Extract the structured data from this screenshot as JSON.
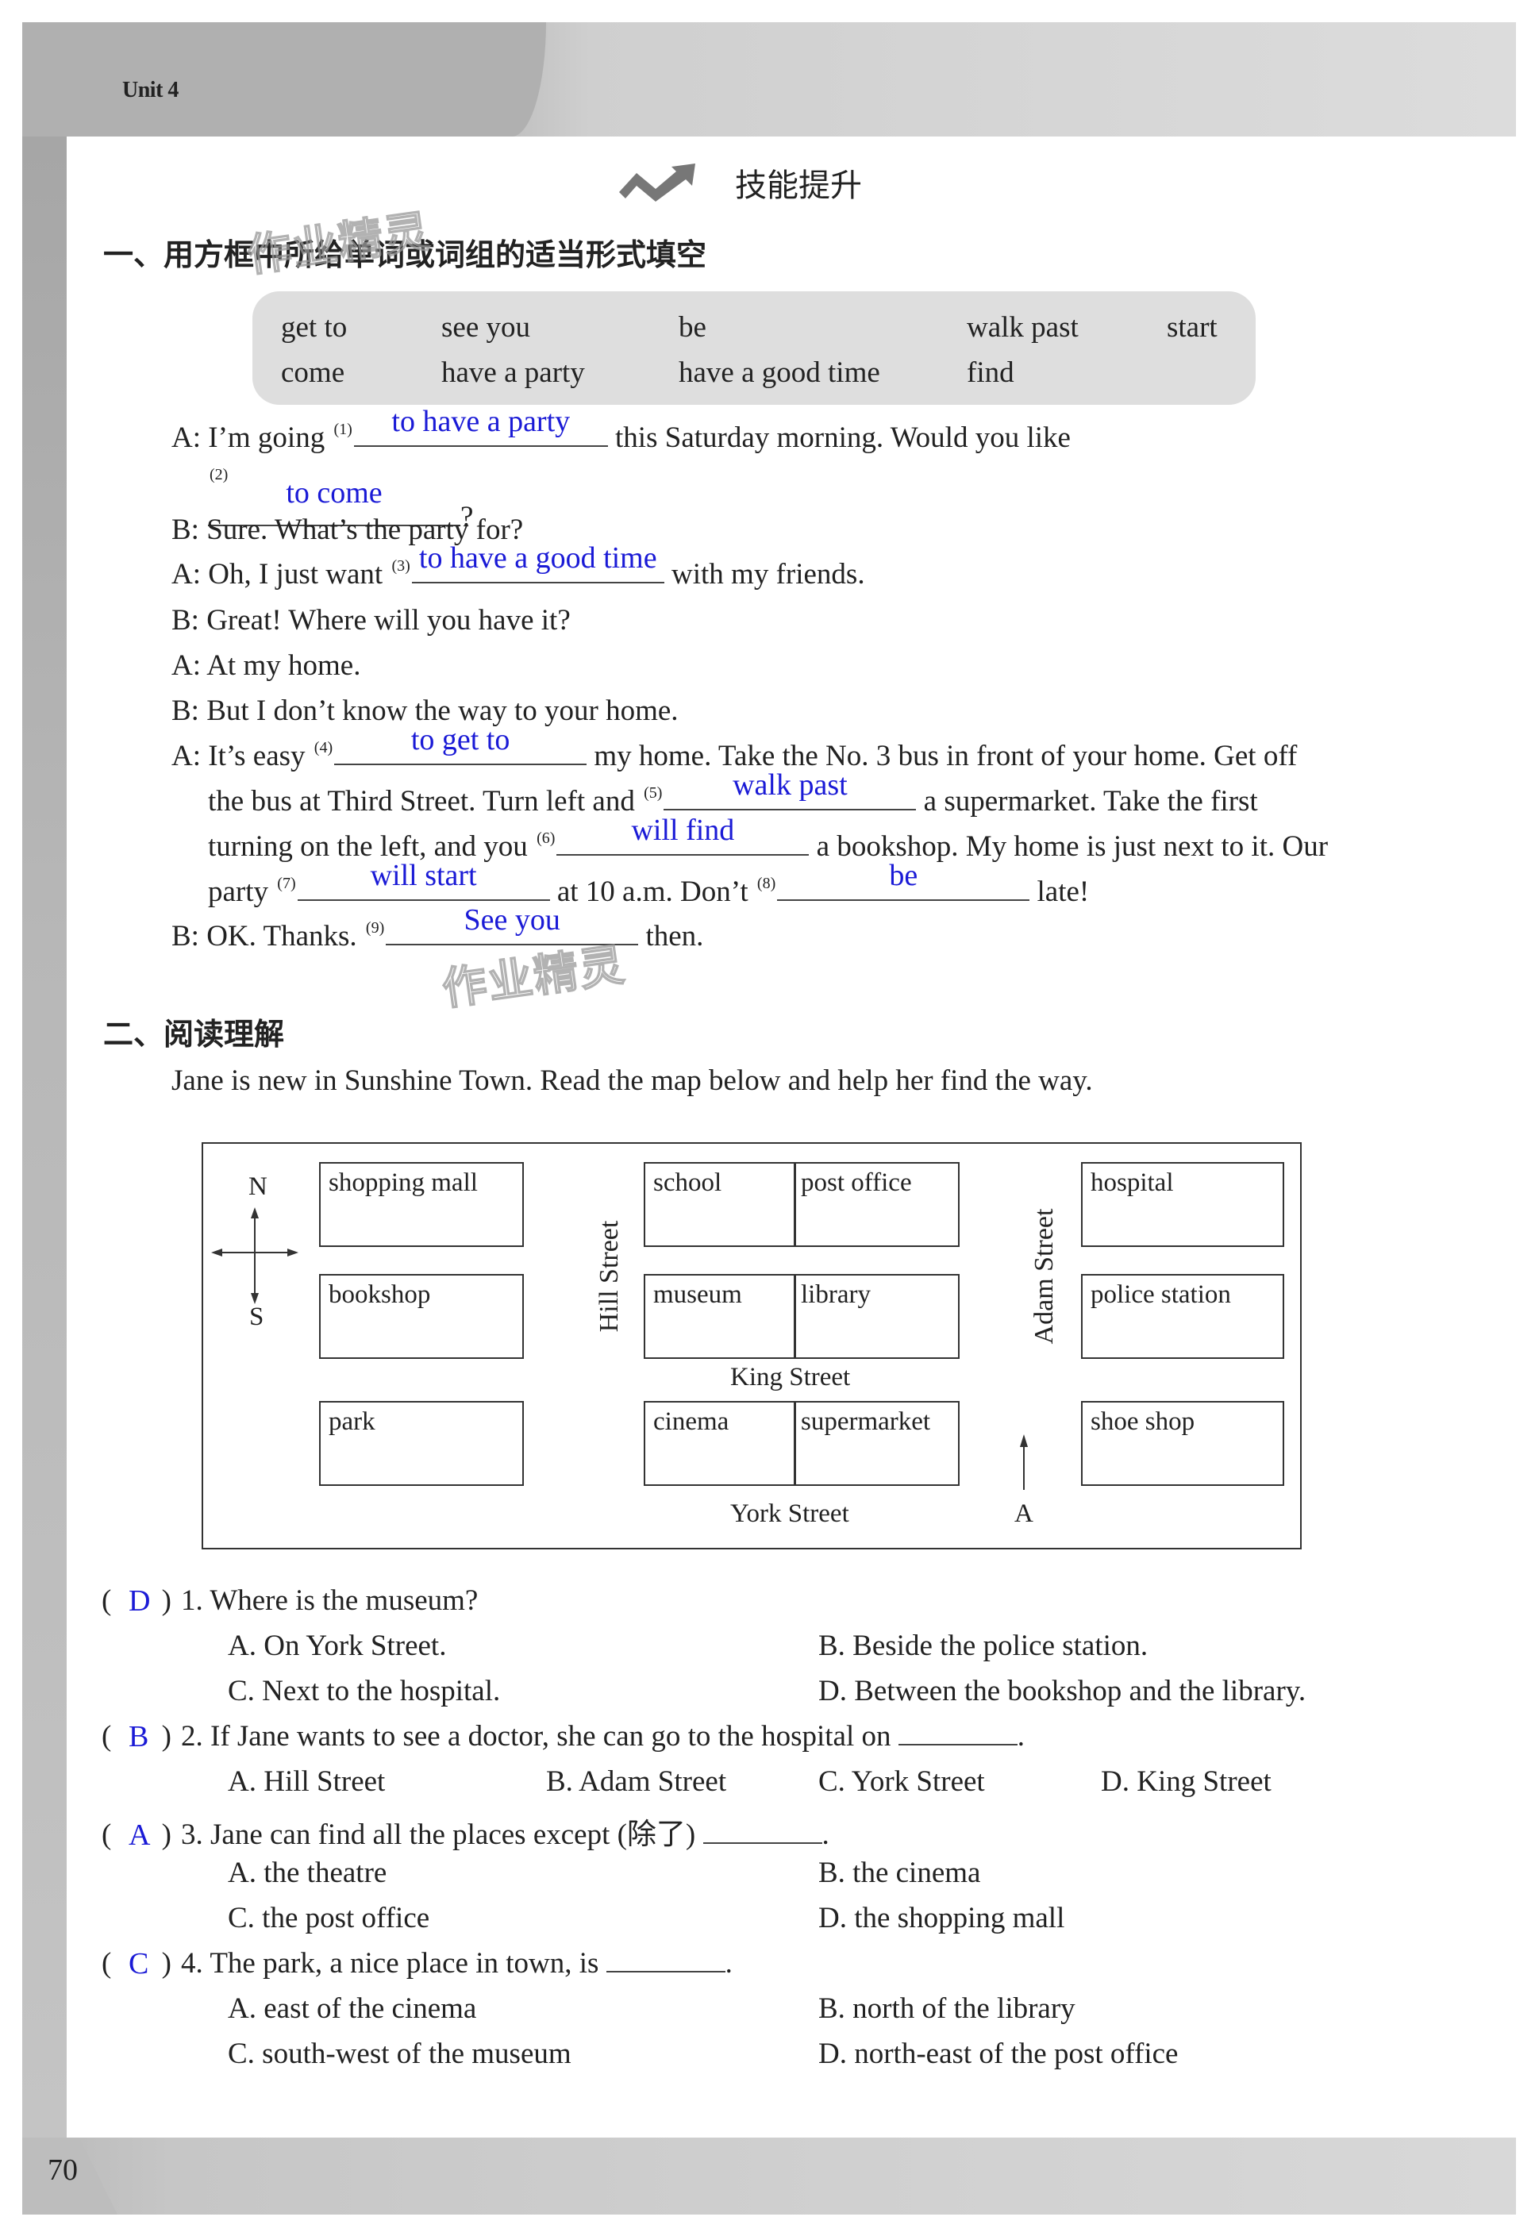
{
  "header": {
    "unit_label": "Unit 4",
    "skill_title": "技能提升",
    "skill_icon": "trend-up-arrow-icon",
    "page_number": "70"
  },
  "watermark": "作业精灵",
  "section1": {
    "title": "一、用方框中所给单词或词组的适当形式填空",
    "word_bank": [
      [
        "get to",
        "see you",
        "be",
        "walk past",
        "start"
      ],
      [
        "come",
        "have a party",
        "have a good time",
        "find"
      ]
    ],
    "lines": {
      "l1": {
        "pre": "A: I’m going",
        "num": "(1)",
        "answer": "to have a party",
        "post": "this Saturday morning. Would you like"
      },
      "l2": {
        "num": "(2)",
        "answer": "to come",
        "post": "?"
      },
      "l3": "B: Sure. What’s the party for?",
      "l4": {
        "pre": "A: Oh, I just want",
        "num": "(3)",
        "answer": "to have a good time",
        "post": "with my friends."
      },
      "l5": "B: Great! Where will you have it?",
      "l6": "A: At my home.",
      "l7": "B: But I don’t know the way to your home.",
      "l8": {
        "pre": "A: It’s easy",
        "num": "(4)",
        "answer": "to get to",
        "post": "my home. Take the No. 3 bus in front of your home. Get off"
      },
      "l9": {
        "pre": "the bus at Third Street. Turn left and",
        "num": "(5)",
        "answer": "walk past",
        "post": "a supermarket. Take the first"
      },
      "l10": {
        "pre": "turning on the left, and you",
        "num": "(6)",
        "answer": "will find",
        "post": "a bookshop. My home is just next to it. Our"
      },
      "l11": {
        "pre": "party",
        "num": "(7)",
        "answer": "will start",
        "mid": "at 10 a.m. Don’t",
        "num2": "(8)",
        "answer2": "be",
        "post": "late!"
      },
      "l12": {
        "pre": "B: OK. Thanks.",
        "num": "(9)",
        "answer": "See you",
        "post": "then."
      }
    }
  },
  "section2": {
    "title": "二、阅读理解",
    "intro": "Jane is new in Sunshine Town. Read the map below and help her find the way.",
    "map": {
      "compass": {
        "north": "N",
        "south": "S"
      },
      "buildings": {
        "shopping_mall": "shopping mall",
        "bookshop": "bookshop",
        "park": "park",
        "school": "school",
        "post_office": "post office",
        "museum": "museum",
        "library": "library",
        "cinema": "cinema",
        "supermarket": "supermarket",
        "hospital": "hospital",
        "police_station": "police station",
        "shoe_shop": "shoe shop"
      },
      "streets": {
        "hill": "Hill Street",
        "adam": "Adam Street",
        "king": "King Street",
        "york": "York Street"
      },
      "marker": "A"
    },
    "questions": [
      {
        "answer": "D",
        "text": "1. Where is the museum?",
        "options": [
          "A. On York Street.",
          "B. Beside the police station.",
          "C. Next to the hospital.",
          "D. Between the bookshop and the library."
        ]
      },
      {
        "answer": "B",
        "text": "2. If Jane wants to see a doctor, she can go to the hospital on",
        "options": [
          "A. Hill Street",
          "B. Adam Street",
          "C. York Street",
          "D. King Street"
        ]
      },
      {
        "answer": "A",
        "text": "3. Jane can find all the places except (除了)",
        "options": [
          "A. the theatre",
          "B. the cinema",
          "C. the post office",
          "D. the shopping mall"
        ]
      },
      {
        "answer": "C",
        "text": "4. The park, a nice place in town, is",
        "options": [
          "A. east of the cinema",
          "B. north of the library",
          "C. south-west of the museum",
          "D. north-east of the post office"
        ]
      }
    ]
  }
}
